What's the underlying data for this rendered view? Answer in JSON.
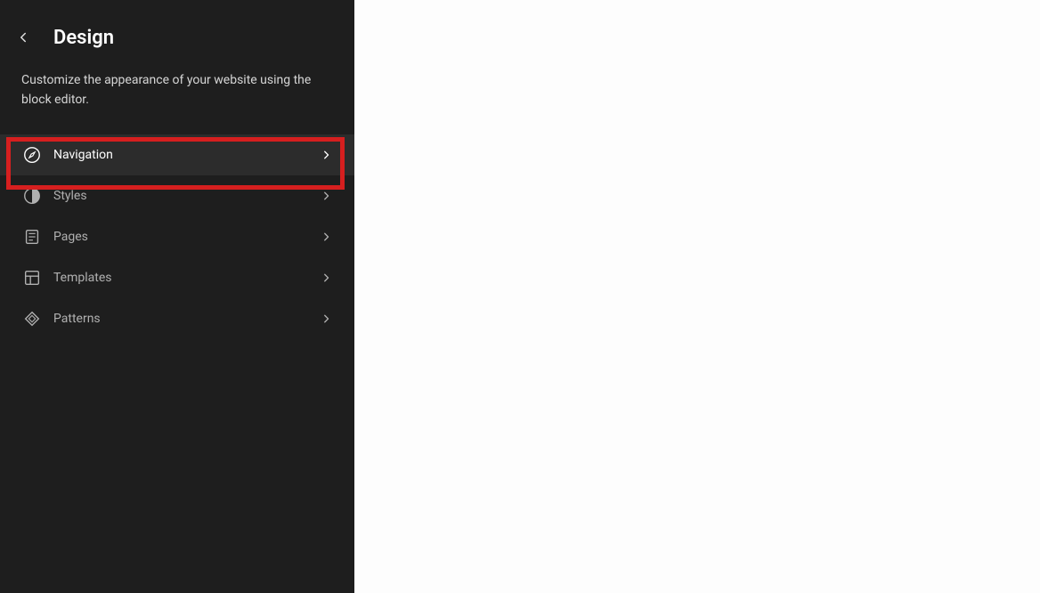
{
  "sidebar": {
    "title": "Design",
    "description": "Customize the appearance of your website using the block editor.",
    "items": [
      {
        "label": "Navigation",
        "icon": "compass-icon",
        "active": true
      },
      {
        "label": "Styles",
        "icon": "styles-icon",
        "active": false
      },
      {
        "label": "Pages",
        "icon": "page-icon",
        "active": false
      },
      {
        "label": "Templates",
        "icon": "layout-icon",
        "active": false
      },
      {
        "label": "Patterns",
        "icon": "patterns-icon",
        "active": false
      }
    ]
  },
  "highlight": {
    "target": "navigation"
  }
}
